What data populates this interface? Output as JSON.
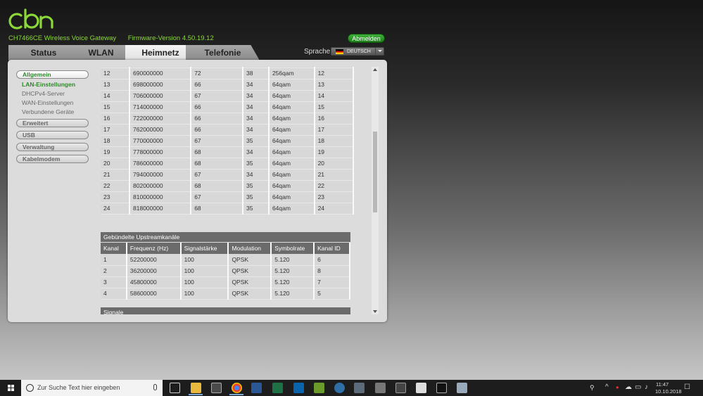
{
  "header": {
    "logo_text": "cbn",
    "device_name": "CH7466CE  Wireless Voice Gateway",
    "firmware_label": "Firmware-Version  4.50.19.12",
    "logout_label": "Abmelden",
    "language_label": "Sprache",
    "language_value": "DEUTSCH"
  },
  "tabs": [
    {
      "label": "Status"
    },
    {
      "label": "WLAN"
    },
    {
      "label": "Heimnetz"
    },
    {
      "label": "Telefonie"
    }
  ],
  "sidebar": {
    "allgemein": "Allgemein",
    "sub": [
      "LAN-Einstellungen",
      "DHCPv4-Server",
      "WAN-Einstellungen",
      "Verbundene Geräte"
    ],
    "erweitert": "Erweitert",
    "usb": "USB",
    "verwaltung": "Verwaltung",
    "kabelmodem": "Kabelmodem"
  },
  "downstream_rows": [
    [
      "12",
      "690000000",
      "72",
      "38",
      "256qam",
      "12"
    ],
    [
      "13",
      "698000000",
      "66",
      "34",
      "64qam",
      "13"
    ],
    [
      "14",
      "706000000",
      "67",
      "34",
      "64qam",
      "14"
    ],
    [
      "15",
      "714000000",
      "66",
      "34",
      "64qam",
      "15"
    ],
    [
      "16",
      "722000000",
      "66",
      "34",
      "64qam",
      "16"
    ],
    [
      "17",
      "762000000",
      "66",
      "34",
      "64qam",
      "17"
    ],
    [
      "18",
      "770000000",
      "67",
      "35",
      "64qam",
      "18"
    ],
    [
      "19",
      "778000000",
      "68",
      "34",
      "64qam",
      "19"
    ],
    [
      "20",
      "786000000",
      "68",
      "35",
      "64qam",
      "20"
    ],
    [
      "21",
      "794000000",
      "67",
      "34",
      "64qam",
      "21"
    ],
    [
      "22",
      "802000000",
      "68",
      "35",
      "64qam",
      "22"
    ],
    [
      "23",
      "810000000",
      "67",
      "35",
      "64qam",
      "23"
    ],
    [
      "24",
      "818000000",
      "68",
      "35",
      "64qam",
      "24"
    ]
  ],
  "upstream": {
    "title": "Gebündelte Upstreamkanäle",
    "headers": [
      "Kanal",
      "Frequenz (Hz)",
      "Signalstärke",
      "Modulation",
      "Symbolrate",
      "Kanal ID"
    ],
    "rows": [
      [
        "1",
        "52200000",
        "100",
        "QPSK",
        "5.120",
        "6"
      ],
      [
        "2",
        "36200000",
        "100",
        "QPSK",
        "5.120",
        "8"
      ],
      [
        "3",
        "45800000",
        "100",
        "QPSK",
        "5.120",
        "7"
      ],
      [
        "4",
        "58600000",
        "100",
        "QPSK",
        "5.120",
        "5"
      ]
    ]
  },
  "signale_title": "Signale",
  "taskbar": {
    "search_placeholder": "Zur Suche Text hier eingeben",
    "time": "11:47",
    "date": "10.10.2018"
  }
}
